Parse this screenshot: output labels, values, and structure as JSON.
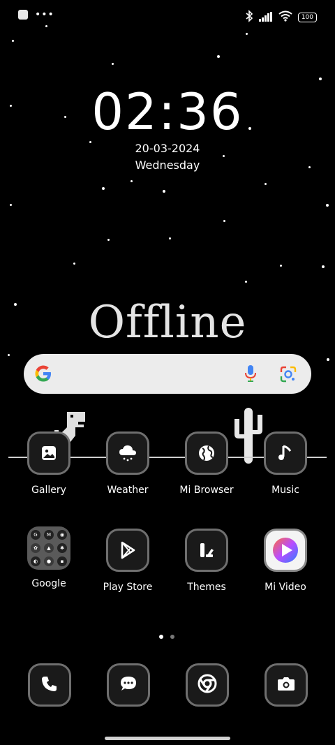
{
  "status_bar": {
    "battery": "100",
    "icons": [
      "notification-square-icon",
      "more-dots-icon",
      "bluetooth-icon",
      "signal-icon",
      "wifi-icon",
      "battery-icon"
    ]
  },
  "clock": {
    "time": "02:36",
    "date": "20-03-2024",
    "day": "Wednesday"
  },
  "wallpaper": {
    "text": "Offline"
  },
  "search_bar": {
    "icons": [
      "google-logo-icon",
      "microphone-icon",
      "google-lens-icon"
    ]
  },
  "apps_row1": [
    {
      "label": "Gallery",
      "icon": "gallery-icon"
    },
    {
      "label": "Weather",
      "icon": "weather-icon"
    },
    {
      "label": "Mi Browser",
      "icon": "browser-globe-icon"
    },
    {
      "label": "Music",
      "icon": "music-note-icon"
    }
  ],
  "apps_row2": [
    {
      "label": "Google",
      "icon": "folder-icon"
    },
    {
      "label": "Play Store",
      "icon": "play-store-icon"
    },
    {
      "label": "Themes",
      "icon": "themes-icon"
    },
    {
      "label": "Mi Video",
      "icon": "mi-video-icon"
    }
  ],
  "page_indicator": {
    "pages": 2,
    "current": 1
  },
  "dock": [
    {
      "icon": "phone-icon"
    },
    {
      "icon": "messages-icon"
    },
    {
      "icon": "chrome-icon"
    },
    {
      "icon": "camera-icon"
    }
  ],
  "colors": {
    "background": "#000000",
    "icon_border": "#6f6f6f",
    "search_bg": "#ececec",
    "google_blue": "#4285F4",
    "google_red": "#EA4335",
    "google_yellow": "#FBBC05",
    "google_green": "#34A853"
  }
}
